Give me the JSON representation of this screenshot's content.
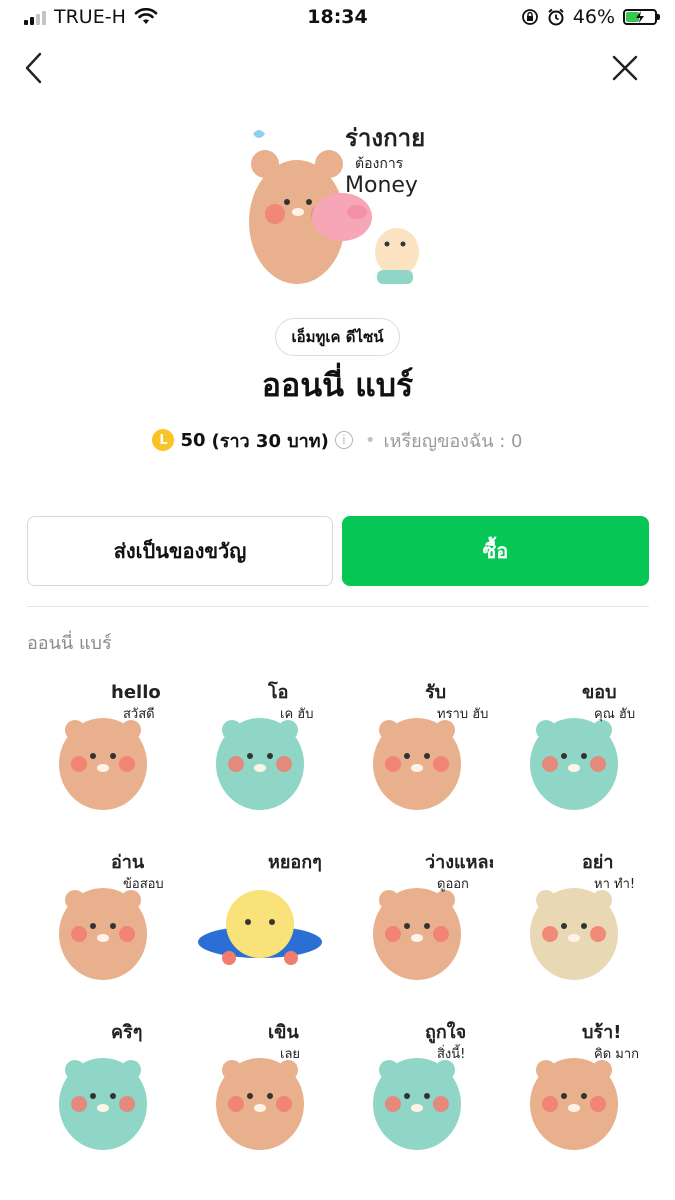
{
  "status_bar": {
    "carrier": "TRUE-H",
    "time": "18:34",
    "battery": "46%",
    "battery_level": 0.46
  },
  "nav": {
    "back_icon": "chevron-left-icon",
    "close_icon": "close-icon"
  },
  "main_sticker": {
    "text_line1": "ร่างกาย",
    "text_line2": "ต้องการ",
    "text_line3": "Money"
  },
  "author": "เอ็มทูเค ดีไซน์",
  "title": "ออนนี่ แบร์",
  "price": {
    "coin_symbol": "L",
    "amount": "50",
    "approx": "(ราว 30 บาท)",
    "my_coins": "เหรียญของฉัน : 0"
  },
  "buttons": {
    "gift": "ส่งเป็นของขวัญ",
    "buy": "ซื้อ"
  },
  "section_title": "ออนนี่ แบร์",
  "stickers": [
    {
      "text": "hello",
      "text2": "สวัสดี"
    },
    {
      "text": "โอ",
      "text2": "เค ฮับ"
    },
    {
      "text": "รับ",
      "text2": "ทราบ ฮับ"
    },
    {
      "text": "ขอบ",
      "text2": "คุณ ฮับ"
    },
    {
      "text": "อ่าน",
      "text2": "ข้อสอบ"
    },
    {
      "text": "หยอกๆ",
      "text2": ""
    },
    {
      "text": "ว่างแหละ",
      "text2": "ดูออก"
    },
    {
      "text": "อย่า",
      "text2": "หา ทำ!"
    },
    {
      "text": "คริๆ",
      "text2": ""
    },
    {
      "text": "เขิน",
      "text2": "เลย"
    },
    {
      "text": "ถูกใจ",
      "text2": "สิ่งนี้!"
    },
    {
      "text": "บร้า!",
      "text2": "คิด มาก"
    }
  ]
}
